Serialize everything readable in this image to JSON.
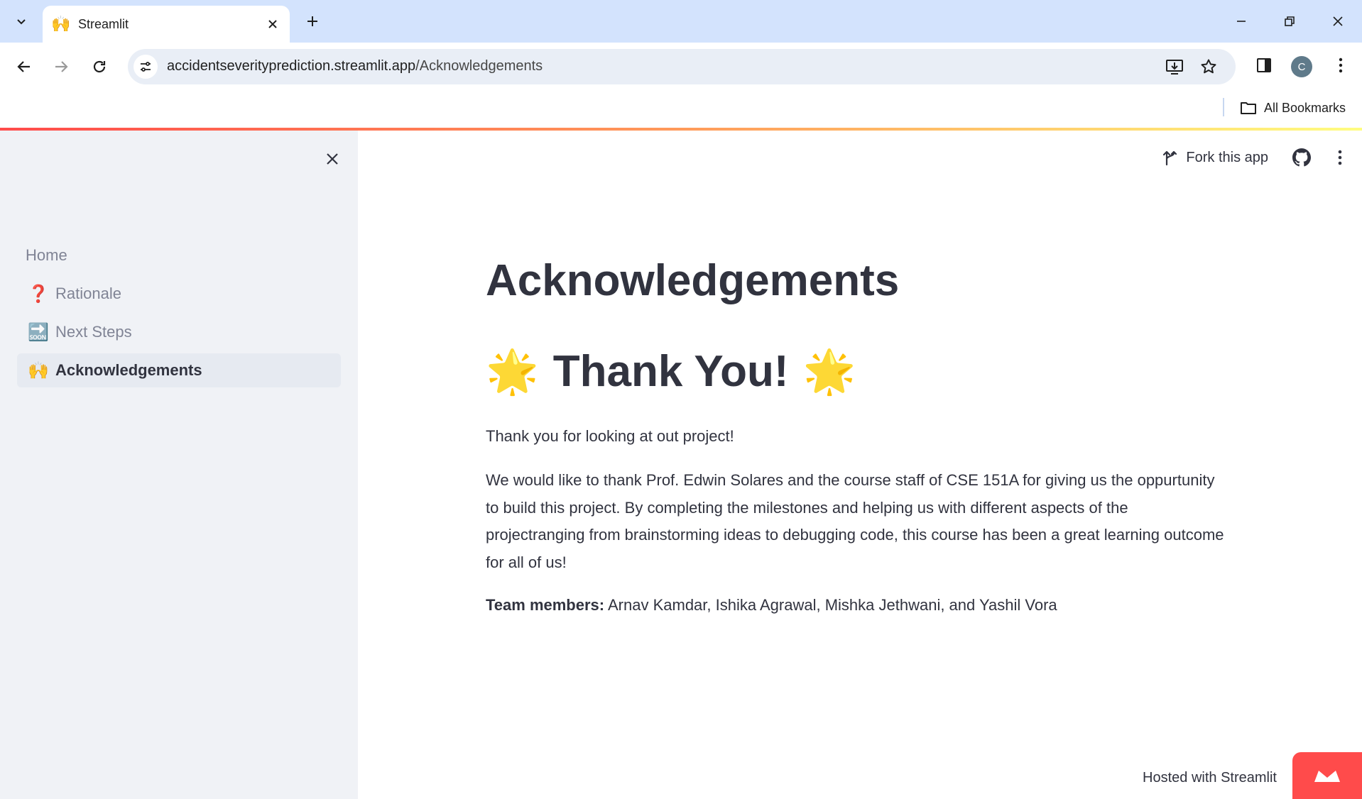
{
  "browser": {
    "tab_title": "Streamlit",
    "tab_favicon": "🙌",
    "url_host": "accidentseverityprediction.streamlit.app",
    "url_path": "/Acknowledgements",
    "profile_initial": "C",
    "bookmarks_label": "All Bookmarks"
  },
  "sidebar": {
    "items": [
      {
        "label": "Home",
        "emoji": ""
      },
      {
        "label": "Rationale",
        "emoji": "❓"
      },
      {
        "label": "Next Steps",
        "emoji": "🔜"
      },
      {
        "label": "Acknowledgements",
        "emoji": "🙌"
      }
    ],
    "active_index": 3
  },
  "header": {
    "fork_label": "Fork this app"
  },
  "main": {
    "title": "Acknowledgements",
    "subtitle": "Thank You!",
    "subtitle_emoji": "🌟",
    "paragraph1": "Thank you for looking at out project!",
    "paragraph2": "We would like to thank Prof. Edwin Solares and the course staff of CSE 151A for giving us the oppurtunity to build this project. By completing the milestones and helping us with different aspects of the projectranging from brainstorming ideas to debugging code, this course has been a great learning outcome for all of us!",
    "team_label": "Team members:",
    "team_members": " Arnav Kamdar, Ishika Agrawal, Mishka Jethwani, and Yashil Vora"
  },
  "footer": {
    "hosted_label": "Hosted with Streamlit"
  },
  "colors": {
    "accent": "#ff4b4b",
    "sidebar_bg": "#f0f2f6",
    "text": "#31333f",
    "chrome_tabbar": "#d3e3fd"
  }
}
